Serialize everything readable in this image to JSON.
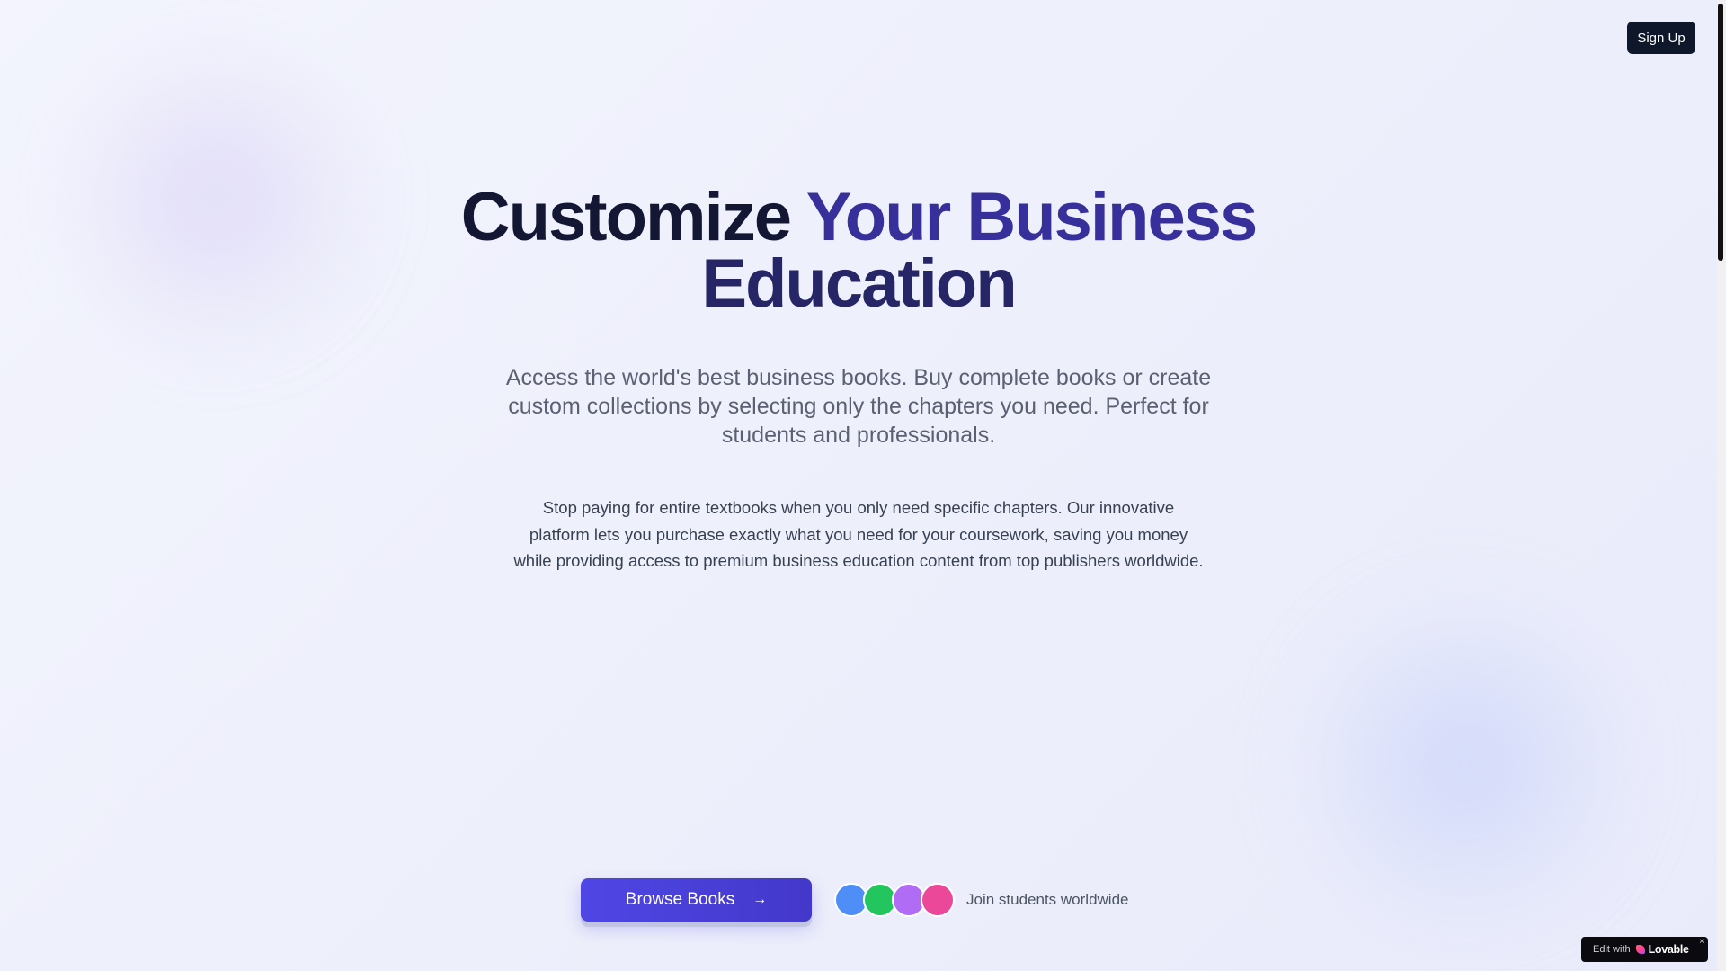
{
  "header": {
    "signup_label": "Sign Up"
  },
  "hero": {
    "title_part1": "Customize",
    "title_part2": "Your Business",
    "title_part3": "Education",
    "subtitle": "Access the world's best business books. Buy complete books or create custom collections by selecting only the chapters you need. Perfect for students and professionals.",
    "body": "Stop paying for entire textbooks when you only need specific chapters. Our innovative platform lets you purchase exactly what you need for your coursework, saving you money while providing access to premium business education content from top publishers worldwide."
  },
  "cta": {
    "browse_label": "Browse Books",
    "browse_icon": "arrow-right-icon",
    "arrow_glyph": "→",
    "join_text": "Join students worldwide",
    "avatars": [
      {
        "color": "#4f8ef7"
      },
      {
        "color": "#22c55e"
      },
      {
        "color": "#b06cf5"
      },
      {
        "color": "#ec4899"
      }
    ]
  },
  "badge": {
    "edit_text": "Edit with",
    "brand": "Lovable",
    "close_glyph": "×"
  },
  "colors": {
    "accent": "#4f46e5",
    "dark": "#0f172a",
    "title_accent": "#372f9a"
  }
}
